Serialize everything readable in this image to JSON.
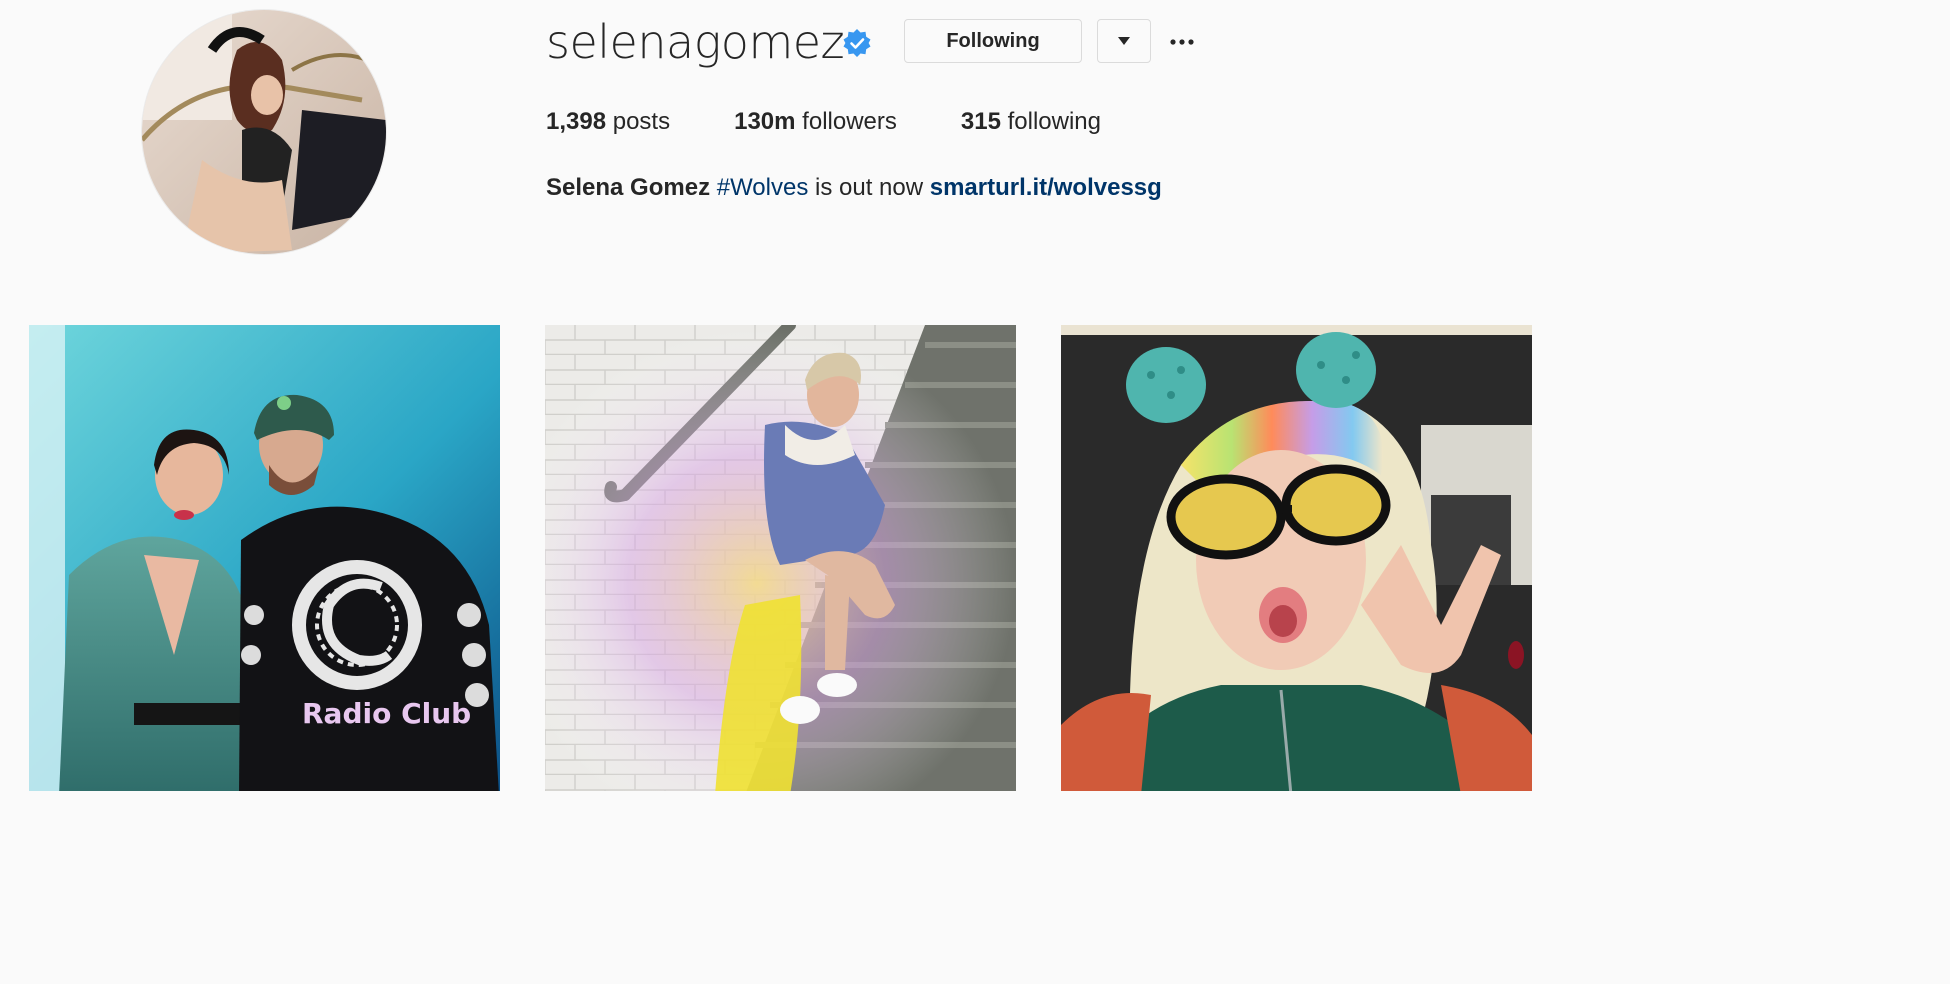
{
  "profile": {
    "username": "selenagomez",
    "verified_icon": "verified-badge-icon",
    "follow_button_label": "Following",
    "dropdown_icon": "caret-down-icon",
    "more_icon": "more-options-icon",
    "stats": {
      "posts_count": "1,398",
      "posts_label": "posts",
      "followers_count": "130m",
      "followers_label": "followers",
      "following_count": "315",
      "following_label": "following"
    },
    "bio": {
      "full_name": "Selena Gomez",
      "hashtag": "#Wolves",
      "text": "is out now",
      "link": "smarturl.it/wolvessg"
    }
  },
  "posts": [
    {
      "label": "Radio Club"
    },
    {
      "label": ""
    },
    {
      "label": ""
    }
  ],
  "colors": {
    "link": "#003569",
    "verified": "#3897f0",
    "border": "#dbdbdb",
    "background": "#fafafa"
  }
}
